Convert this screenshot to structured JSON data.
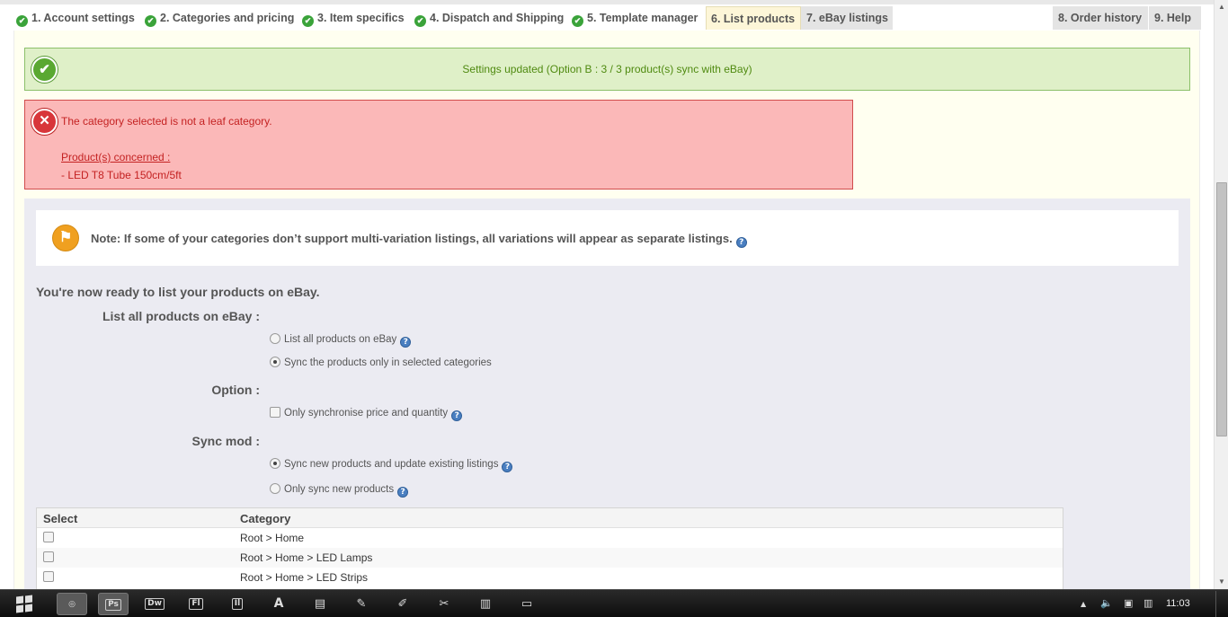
{
  "tabs": [
    {
      "label": "1. Account settings"
    },
    {
      "label": "2. Categories and pricing"
    },
    {
      "label": "3. Item specifics"
    },
    {
      "label": "4. Dispatch and Shipping"
    },
    {
      "label": "5. Template manager"
    },
    {
      "label": "6. List products"
    },
    {
      "label": "7. eBay listings"
    },
    {
      "label": "8. Order history"
    },
    {
      "label": "9. Help"
    }
  ],
  "success": {
    "message": "Settings updated (Option B : 3 / 3 product(s) sync with eBay)"
  },
  "error": {
    "message": "The category selected is not a leaf category.",
    "concerned_label": "Product(s) concerned :",
    "product": "- LED T8 Tube 150cm/5ft"
  },
  "note": {
    "text": "Note: If some of your categories don’t support multi-variation listings, all variations will appear as separate listings."
  },
  "ready_text": "You're now ready to list your products on eBay.",
  "form": {
    "list_all_label": "List all products on eBay :",
    "list_all_option": "List all products on eBay",
    "sync_selected_option": "Sync the products only in selected categories",
    "option_label": "Option :",
    "only_price_qty": "Only synchronise price and quantity",
    "sync_mod_label": "Sync mod :",
    "sync_new_update": "Sync new products and update existing listings",
    "only_sync_new": "Only sync new products"
  },
  "table": {
    "col_select": "Select",
    "col_category": "Category",
    "rows": [
      {
        "category": "Root > Home"
      },
      {
        "category": "Root > Home > LED Lamps"
      },
      {
        "category": "Root > Home > LED Strips"
      }
    ]
  },
  "taskbar": {
    "apps": [
      "Dw",
      "Fl",
      "Il",
      "Ps"
    ],
    "clock": "11:03"
  },
  "colors": {
    "success_bg": "#dff0c8",
    "error_bg": "#fbb8b8",
    "active_tab": "#fdf6d8"
  }
}
